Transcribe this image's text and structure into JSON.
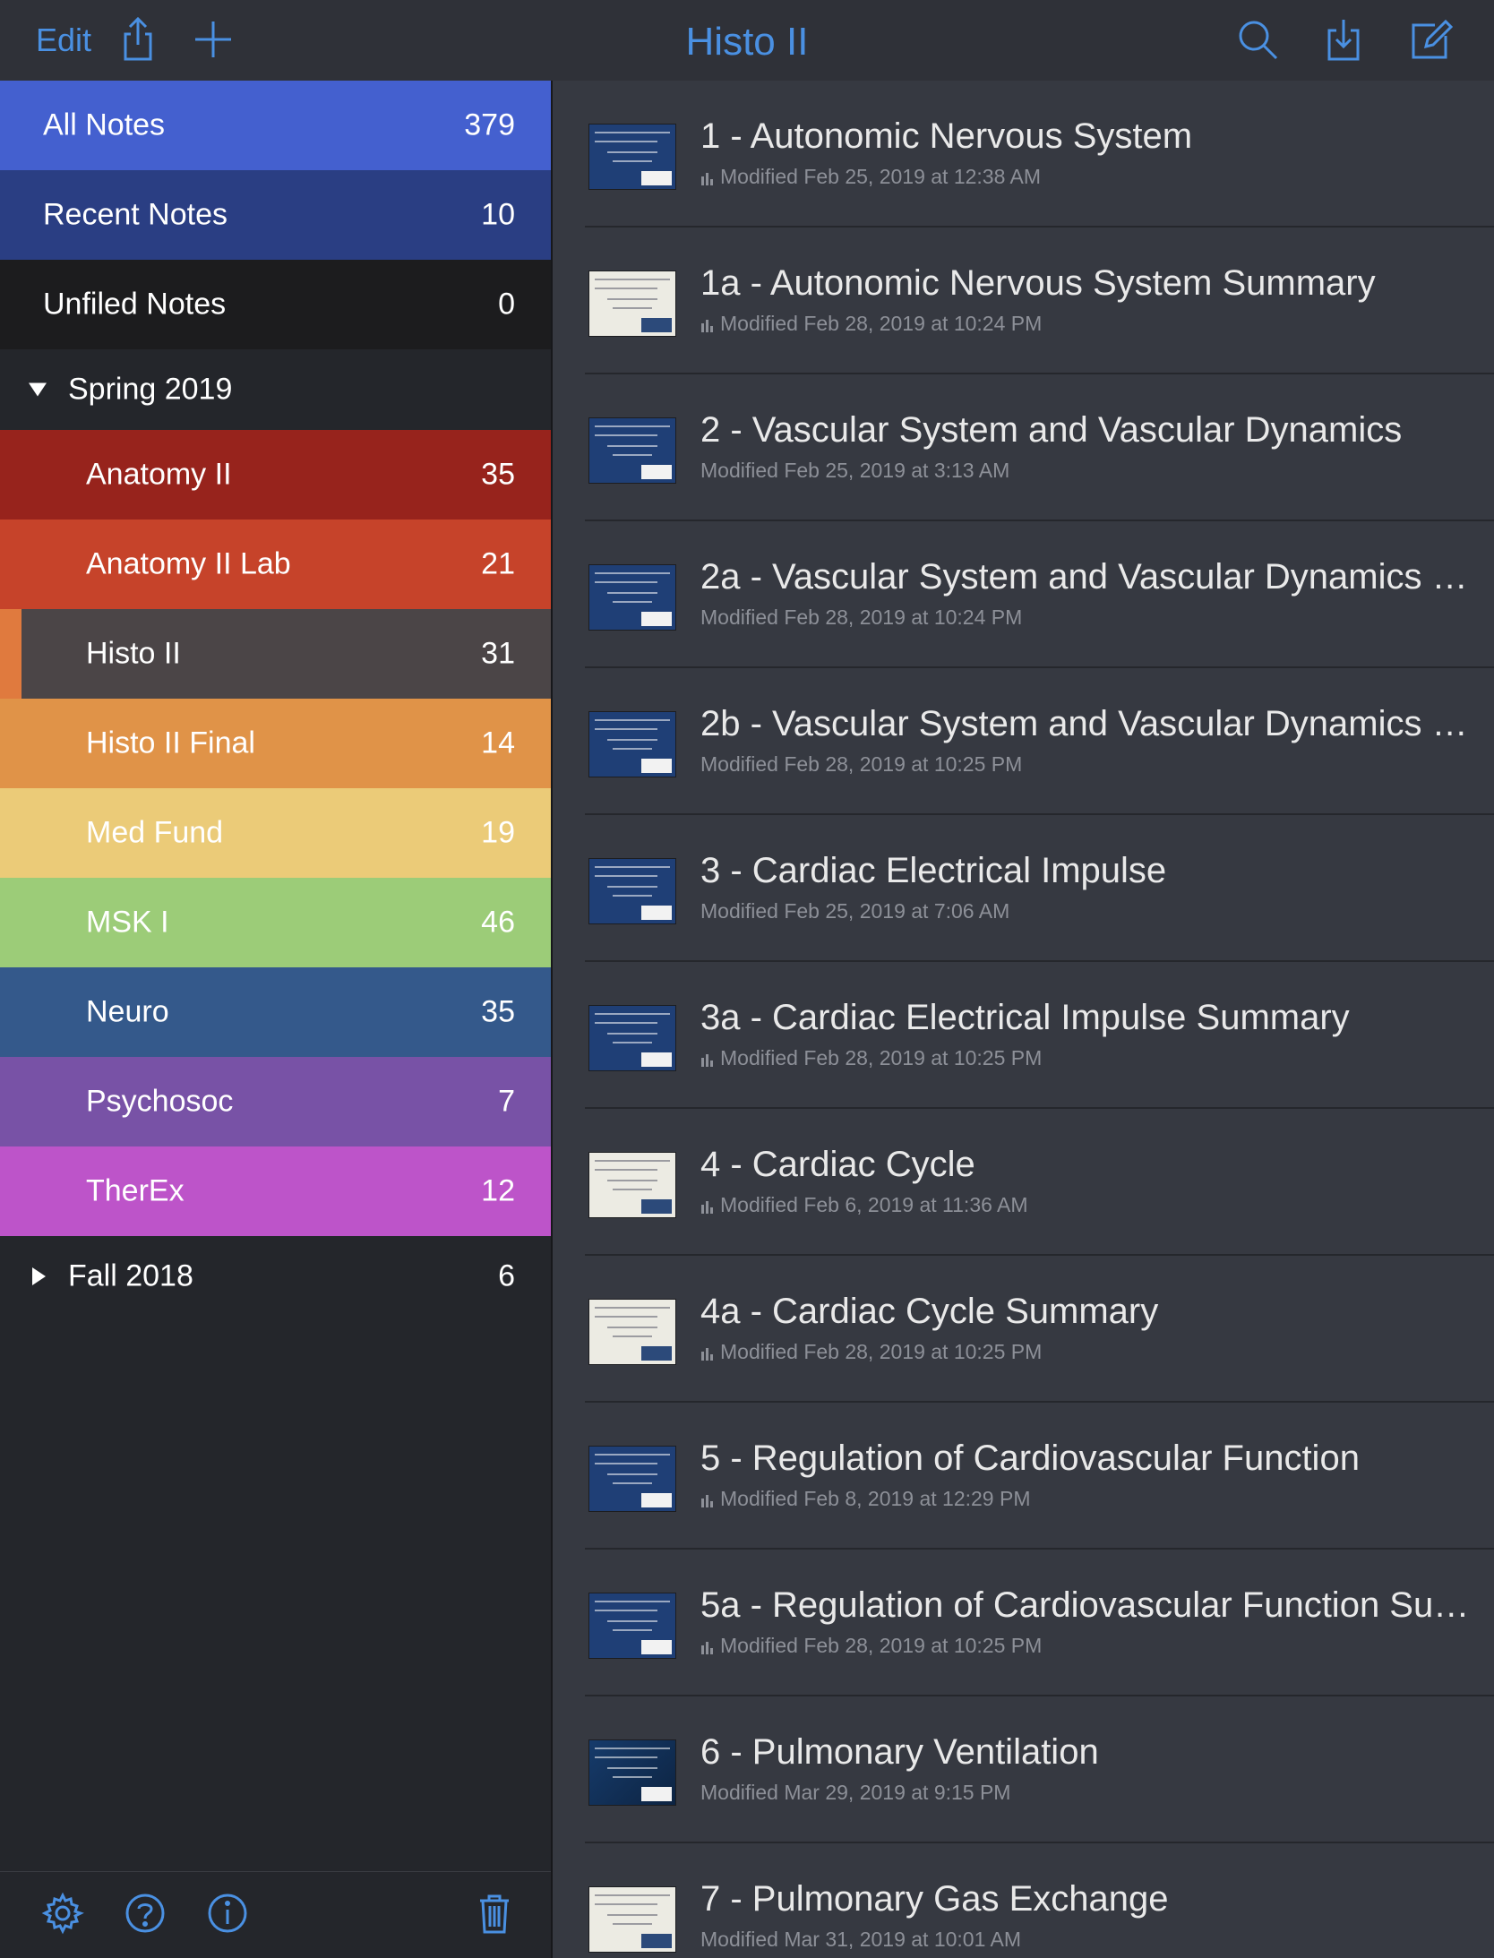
{
  "topbar": {
    "edit_label": "Edit",
    "title": "Histo II",
    "icons": [
      "share-icon",
      "plus-icon",
      "search-icon",
      "import-icon",
      "compose-icon"
    ]
  },
  "sidebar": {
    "items": [
      {
        "label": "All Notes",
        "count": "379",
        "color": "#4460cf"
      },
      {
        "label": "Recent Notes",
        "count": "10",
        "color": "#2a3e83"
      },
      {
        "label": "Unfiled Notes",
        "count": "0",
        "color": "#1c1c1e"
      }
    ],
    "groups": [
      {
        "label": "Spring 2019",
        "count": "",
        "expanded": true,
        "notebooks": [
          {
            "label": "Anatomy II",
            "count": "35",
            "color": "#97231c",
            "selected": false
          },
          {
            "label": "Anatomy II Lab",
            "count": "21",
            "color": "#c6432a",
            "selected": false
          },
          {
            "label": "Histo II",
            "count": "31",
            "color": "#4b4547",
            "selected": true,
            "marker_color": "#e07a3e"
          },
          {
            "label": "Histo II Final",
            "count": "14",
            "color": "#e09348",
            "selected": false
          },
          {
            "label": "Med Fund",
            "count": "19",
            "color": "#ebcb78",
            "selected": false
          },
          {
            "label": "MSK I",
            "count": "46",
            "color": "#9ccc78",
            "selected": false
          },
          {
            "label": "Neuro",
            "count": "35",
            "color": "#34598b",
            "selected": false
          },
          {
            "label": "Psychosoc",
            "count": "7",
            "color": "#7852a6",
            "selected": false
          },
          {
            "label": "TherEx",
            "count": "12",
            "color": "#bd54c9",
            "selected": false
          }
        ]
      },
      {
        "label": "Fall 2018",
        "count": "6",
        "expanded": false,
        "notebooks": []
      }
    ],
    "footer_icons": [
      "settings-icon",
      "help-icon",
      "info-icon",
      "trash-icon"
    ]
  },
  "notes": [
    {
      "title": "1 - Autonomic Nervous System",
      "modified": "Modified Feb 25, 2019 at 12:38 AM",
      "has_bars": true,
      "thumb": "blue"
    },
    {
      "title": "1a - Autonomic Nervous System Summary",
      "modified": "Modified Feb 28, 2019 at 10:24 PM",
      "has_bars": true,
      "thumb": "light"
    },
    {
      "title": "2 - Vascular System and Vascular Dynamics",
      "modified": "Modified Feb 25, 2019 at 3:13 AM",
      "has_bars": false,
      "thumb": "blue"
    },
    {
      "title": "2a - Vascular System and Vascular Dynamics S…",
      "modified": "Modified Feb 28, 2019 at 10:24 PM",
      "has_bars": false,
      "thumb": "blue"
    },
    {
      "title": "2b - Vascular System and Vascular Dynamics S…",
      "modified": "Modified Feb 28, 2019 at 10:25 PM",
      "has_bars": false,
      "thumb": "blue"
    },
    {
      "title": "3 - Cardiac Electrical Impulse",
      "modified": "Modified Feb 25, 2019 at 7:06 AM",
      "has_bars": false,
      "thumb": "blue"
    },
    {
      "title": "3a - Cardiac Electrical Impulse Summary",
      "modified": "Modified Feb 28, 2019 at 10:25 PM",
      "has_bars": true,
      "thumb": "blue"
    },
    {
      "title": "4 - Cardiac Cycle",
      "modified": "Modified Feb 6, 2019 at 11:36 AM",
      "has_bars": true,
      "thumb": "light"
    },
    {
      "title": "4a - Cardiac Cycle Summary",
      "modified": "Modified Feb 28, 2019 at 10:25 PM",
      "has_bars": true,
      "thumb": "light"
    },
    {
      "title": "5 - Regulation of Cardiovascular Function",
      "modified": "Modified Feb 8, 2019 at 12:29 PM",
      "has_bars": true,
      "thumb": "blue"
    },
    {
      "title": "5a - Regulation of Cardiovascular Function Su…",
      "modified": "Modified Feb 28, 2019 at 10:25 PM",
      "has_bars": true,
      "thumb": "blue"
    },
    {
      "title": "6 - Pulmonary Ventilation",
      "modified": "Modified Mar 29, 2019 at 9:15 PM",
      "has_bars": false,
      "thumb": "dark"
    },
    {
      "title": "7 - Pulmonary Gas Exchange",
      "modified": "Modified Mar 31, 2019 at 10:01 AM",
      "has_bars": false,
      "thumb": "light"
    }
  ],
  "colors": {
    "accent": "#4a90e2",
    "sidebar_bg": "#24262b",
    "list_bg": "#363941"
  }
}
